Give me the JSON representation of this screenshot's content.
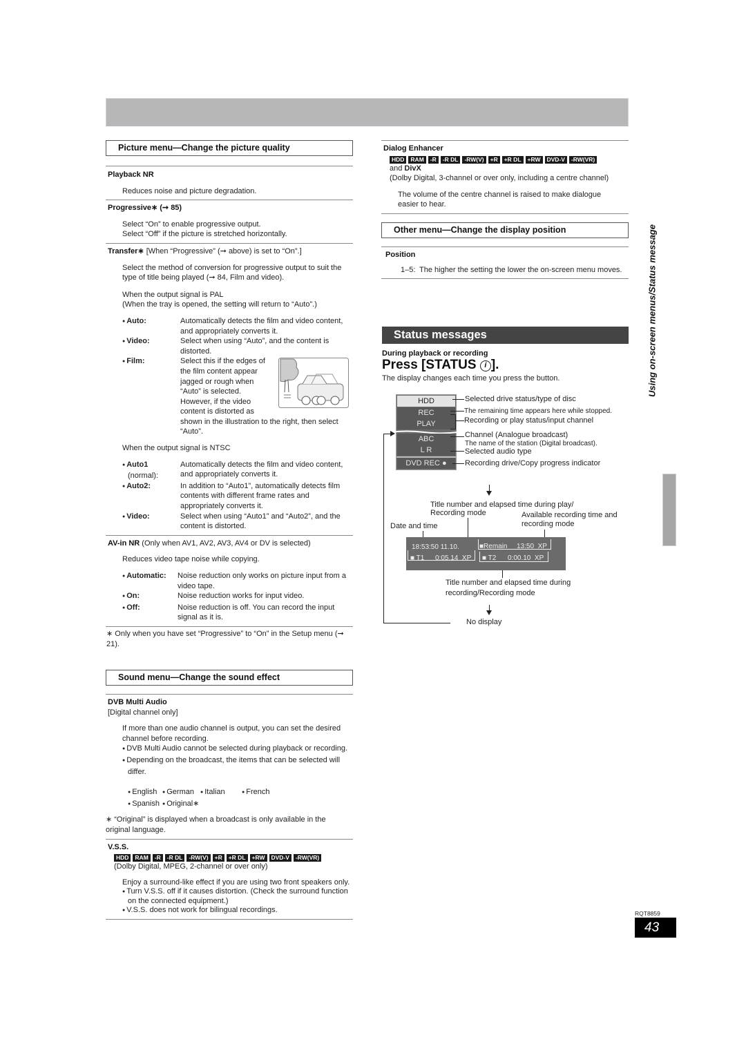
{
  "side_title": "Using on-screen menus/Status message",
  "page_code": "RQT8859",
  "page_number": "43",
  "disc_badges": [
    "HDD",
    "RAM",
    "-R",
    "-R DL",
    "-RW(V)",
    "+R",
    "+R DL",
    "+RW",
    "DVD-V",
    "-RW(VR)"
  ],
  "picture_menu": {
    "heading": "Picture menu—Change the picture quality",
    "playback_nr": {
      "title": "Playback NR",
      "text": "Reduces noise and picture degradation."
    },
    "progressive": {
      "title": "Progressive∗ (➞ 85)",
      "line1": "Select “On” to enable progressive output.",
      "line2": "Select “Off” if the picture is stretched horizontally."
    },
    "transfer": {
      "title": "Transfer∗",
      "title_note": " [When “Progressive” (➞ above) is set to “On”.]",
      "intro": "Select the method of conversion for progressive output to suit the type of title being played (➞ 84, Film and video).",
      "pal_line1": "When the output signal is PAL",
      "pal_line2": "(When the tray is opened, the setting will return to “Auto”.)",
      "pal_options": [
        {
          "key": "Auto:",
          "text": "Automatically detects the film and video content, and appropriately converts it."
        },
        {
          "key": "Video:",
          "text": "Select when using “Auto”, and the content is distorted."
        },
        {
          "key": "Film:",
          "text": "Select this if the edges of the film content appear jagged or rough when “Auto” is selected. However, if the video content is distorted as",
          "text_cont": "shown in the illustration to the right, then select “Auto”."
        }
      ],
      "ntsc_line": "When the output signal is NTSC",
      "ntsc_options": [
        {
          "key": "Auto1",
          "key2": "(normal):",
          "text": "Automatically detects the film and video content, and appropriately converts it."
        },
        {
          "key": "Auto2:",
          "text": "In addition to “Auto1”, automatically detects film contents with different frame rates and appropriately converts it."
        },
        {
          "key": "Video:",
          "text": "Select when using “Auto1” and “Auto2”, and the content is distorted."
        }
      ]
    },
    "avin_nr": {
      "title": "AV-in NR",
      "title_note": " (Only when AV1, AV2, AV3, AV4 or DV is selected)",
      "text": "Reduces video tape noise while copying.",
      "options": [
        {
          "key": "Automatic:",
          "text": "Noise reduction only works on picture input from a video tape."
        },
        {
          "key": "On:",
          "text": "Noise reduction works for input video."
        },
        {
          "key": "Off:",
          "text": "Noise reduction is off. You can record the input signal as it is."
        }
      ]
    },
    "footnote": "∗ Only when you have set “Progressive” to “On” in the Setup menu (➞ 21)."
  },
  "sound_menu": {
    "heading": "Sound menu—Change the sound effect",
    "dvb": {
      "title": "DVB Multi Audio",
      "note": "[Digital channel only]",
      "text": "If more than one audio channel is output, you can set the desired channel before recording.",
      "bullets": [
        "DVB Multi Audio cannot be selected during playback or recording.",
        "Depending on the broadcast, the items that can be selected will differ."
      ],
      "languages_row1": [
        "English",
        "German",
        "Italian",
        "French"
      ],
      "languages_row2": [
        "Spanish",
        "Original∗"
      ],
      "footnote": "∗ “Original” is displayed when a broadcast is only available in the original language."
    },
    "vss": {
      "title": "V.S.S.",
      "note": "(Dolby Digital, MPEG, 2-channel or over only)",
      "text": "Enjoy a surround-like effect if you are using two front speakers only.",
      "bullets": [
        "Turn V.S.S. off if it causes distortion. (Check the surround function on the connected equipment.)",
        "V.S.S. does not work for bilingual recordings."
      ]
    }
  },
  "dialog_enhancer": {
    "title": "Dialog Enhancer",
    "and_text": "and ",
    "divx": "DivX",
    "note": "(Dolby Digital, 3-channel or over only, including a centre channel)",
    "text": "The volume of the centre channel is raised to make dialogue easier to hear."
  },
  "other_menu": {
    "heading": "Other menu—Change the display position",
    "position": {
      "title": "Position",
      "key": "1–5:",
      "text": "The higher the setting the lower the on-screen menu moves."
    }
  },
  "status": {
    "heading": "Status messages",
    "during": "During playback or recording",
    "press": "Press [STATUS ",
    "press_end": "].",
    "info_glyph": "i",
    "desc": "The display changes each time you press the button.",
    "osd_items": [
      "HDD",
      "REC",
      "PLAY",
      "ABC",
      "L R",
      "DVD REC ●"
    ],
    "osd_labels": {
      "drive": "Selected drive status/type of disc",
      "remaining": "The remaining time appears here while stopped.",
      "rec_play": "Recording or play status/input channel",
      "channel": "Channel (Analogue broadcast)",
      "station": "The name of the station (Digital broadcast).",
      "audio": "Selected audio type",
      "progress": "Recording drive/Copy progress indicator"
    },
    "bar_labels": {
      "title_play": "Title number and elapsed time during play/",
      "rec_mode": "Recording mode",
      "available": "Available recording time and",
      "available2": "recording mode",
      "date": "Date and time",
      "title_rec": "Title number and elapsed time during",
      "title_rec2": "recording/Recording mode",
      "no_display": "No display"
    },
    "bar": {
      "datetime": "18:53:50 11.10.",
      "remain_label": "■Remain",
      "remain_value": "13:50  XP",
      "t1": "■ T1",
      "t1_time": "0:05.14  XP",
      "t2": "■ T2",
      "t2_time": "0:00.10  XP"
    }
  }
}
